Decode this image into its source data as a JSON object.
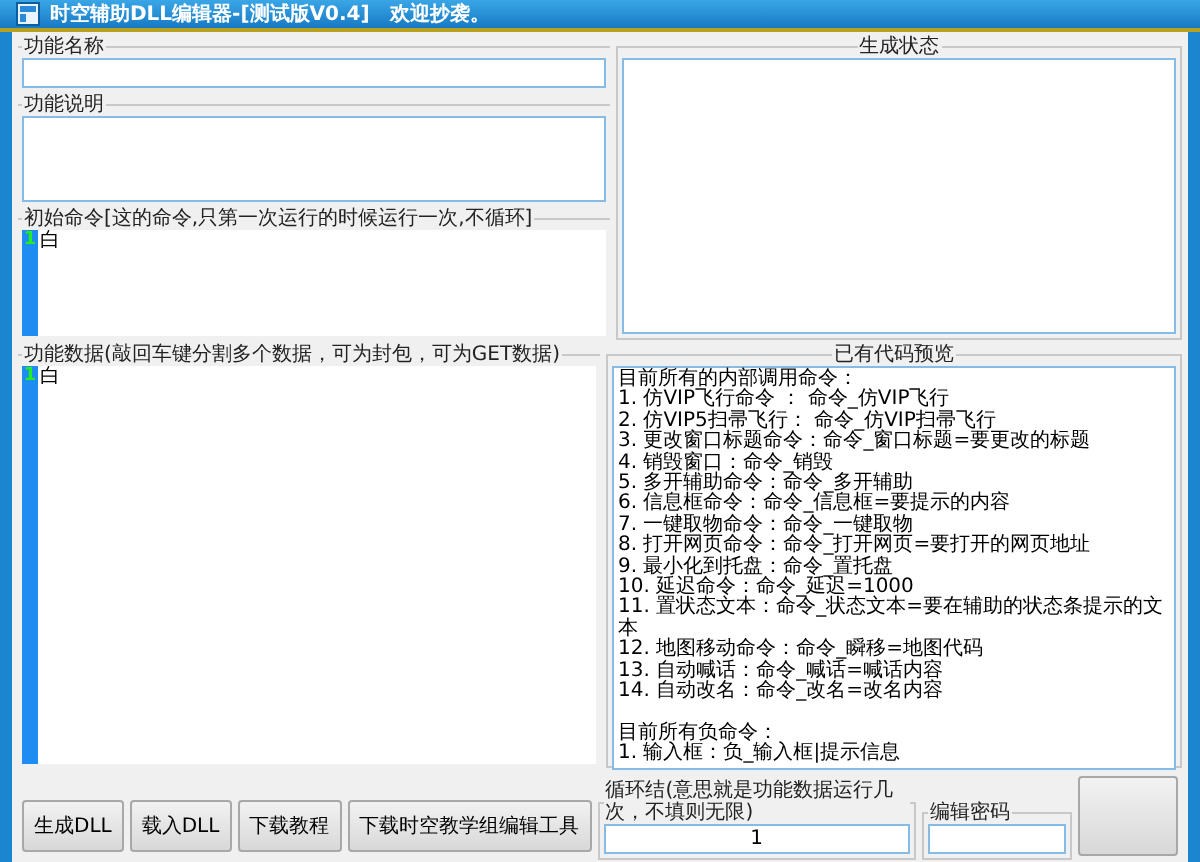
{
  "window": {
    "title": "时空辅助DLL编辑器-[测试版V0.4]　欢迎抄袭。"
  },
  "function_name": {
    "label": "功能名称"
  },
  "function_desc": {
    "label": "功能说明"
  },
  "init_command": {
    "label": "初始命令[这的命令,只第一次运行的时候运行一次,不循环]",
    "line_number": "1",
    "text": "白"
  },
  "status": {
    "label": "生成状态"
  },
  "function_data": {
    "label": "功能数据(敲回车键分割多个数据，可为封包，可为GET数据)",
    "line_number": "1",
    "text": "白"
  },
  "preview": {
    "label": "已有代码预览",
    "lines": [
      "目前所有的内部调用命令：",
      "1. 仿VIP飞行命令 ： 命令_仿VIP飞行",
      "2. 仿VIP5扫帚飞行： 命令_仿VIP扫帚飞行",
      "3. 更改窗口标题命令：命令_窗口标题=要更改的标题",
      "4. 销毁窗口：命令_销毁",
      "5. 多开辅助命令：命令_多开辅助",
      "6. 信息框命令：命令_信息框=要提示的内容",
      "7. 一键取物命令：命令_一键取物",
      "8. 打开网页命令：命令_打开网页=要打开的网页地址",
      "9. 最小化到托盘：命令_置托盘",
      "10. 延迟命令：命令_延迟=1000",
      "11. 置状态文本：命令_状态文本=要在辅助的状态条提示的文本",
      "12. 地图移动命令：命令_瞬移=地图代码",
      "13. 自动喊话：命令_喊话=喊话内容",
      "14. 自动改名：命令_改名=改名内容"
    ],
    "negative_lines": [
      "目前所有负命令：",
      "1. 输入框：负_输入框|提示信息"
    ]
  },
  "buttons": [
    "生成DLL",
    "载入DLL",
    "下载教程",
    "下载时空教学组编辑工具"
  ],
  "loop": {
    "label": "循环结(意思就是功能数据运行几次，不填则无限)",
    "value": "1"
  },
  "password": {
    "label": "编辑密码"
  }
}
